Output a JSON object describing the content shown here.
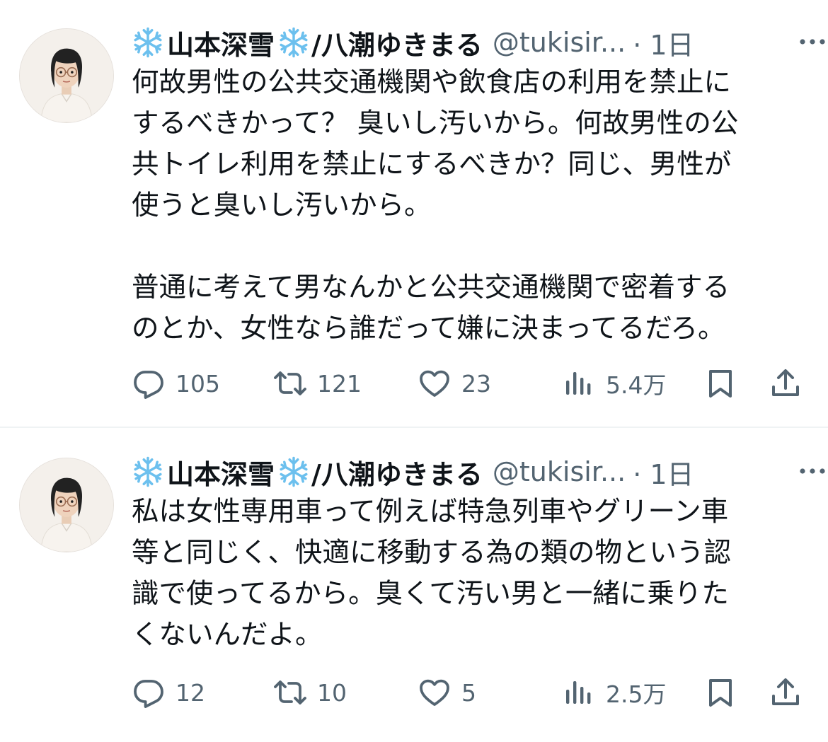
{
  "tweets": [
    {
      "display_name": "山本深雪",
      "display_name_suffix": "/八潮ゆきまる",
      "handle": "@tukisir...",
      "time": "· 1日",
      "text": "何故男性の公共交通機関や飲食店の利用を禁止に\nするべきかって？ 臭いし汚いから。何故男性の公\n共トイレ利用を禁止にするべきか？同じ、男性が\n使うと臭いし汚いから。\n\n普通に考えて男なんかと公共交通機関で密着する\nのとか、女性なら誰だって嫌に決まってるだろ。",
      "replies": "105",
      "reposts": "121",
      "likes": "23",
      "views": "5.4万"
    },
    {
      "display_name": "山本深雪",
      "display_name_suffix": "/八潮ゆきまる",
      "handle": "@tukisir...",
      "time": "· 1日",
      "text": "私は女性専用車って例えば特急列車やグリーン車\n等と同じく、快適に移動する為の類の物という認\n識で使ってるから。臭くて汚い男と一緒に乗りた\nくないんだよ。",
      "replies": "12",
      "reposts": "10",
      "likes": "5",
      "views": "2.5万"
    }
  ],
  "icons": {
    "name_decoration": "snowflake-icon",
    "more": "more-dots-icon",
    "reply": "reply-icon",
    "repost": "repost-icon",
    "like": "heart-icon",
    "views": "views-icon",
    "bookmark": "bookmark-icon",
    "share": "share-icon"
  },
  "colors": {
    "text": "#0f1419",
    "secondary": "#536471",
    "divider": "#eff3f4",
    "snowflake": "#7fc8f0"
  }
}
